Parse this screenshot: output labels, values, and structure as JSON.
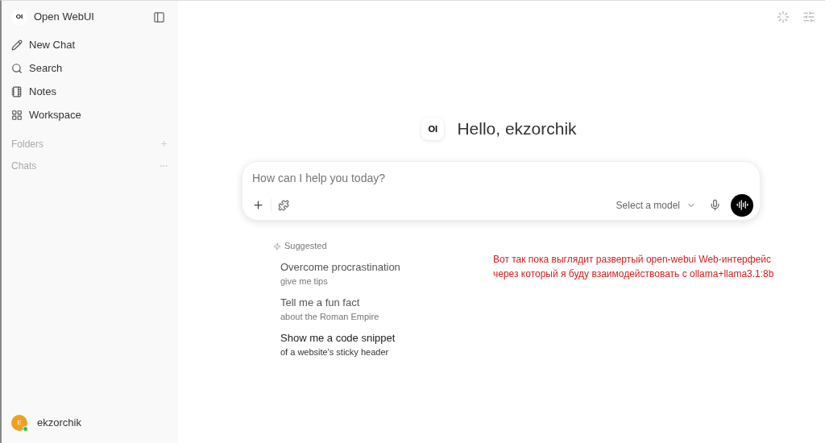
{
  "sidebar": {
    "brand": {
      "logo": "OI",
      "name": "Open WebUI"
    },
    "items": [
      {
        "kind": "pencil",
        "label": "New Chat"
      },
      {
        "kind": "search",
        "label": "Search"
      },
      {
        "kind": "notes",
        "label": "Notes"
      },
      {
        "kind": "grid",
        "label": "Workspace"
      }
    ],
    "sections": [
      {
        "kind": "plus",
        "label": "Folders"
      },
      {
        "kind": "dots",
        "label": "Chats"
      }
    ],
    "user": {
      "initial": "E",
      "name": "ekzorchik",
      "online": true
    }
  },
  "main": {
    "greeting": {
      "logo": "OI",
      "text": "Hello, ekzorchik"
    },
    "composer": {
      "placeholder": "How can I help you today?",
      "model": "Select a model"
    },
    "suggested": {
      "title": "Suggested",
      "items": [
        {
          "title": "Overcome procrastination",
          "subtitle": "give me tips",
          "highlighted": false
        },
        {
          "title": "Tell me a fun fact",
          "subtitle": "about the Roman Empire",
          "highlighted": false
        },
        {
          "title": "Show me a code snippet",
          "subtitle": "of a website's sticky header",
          "highlighted": true
        }
      ]
    },
    "note": [
      "Вот так пока выглядит развертый open-webui Web-интерфейс",
      "через который я буду взаимодействовать с ollama+llama3.1:8b"
    ]
  }
}
